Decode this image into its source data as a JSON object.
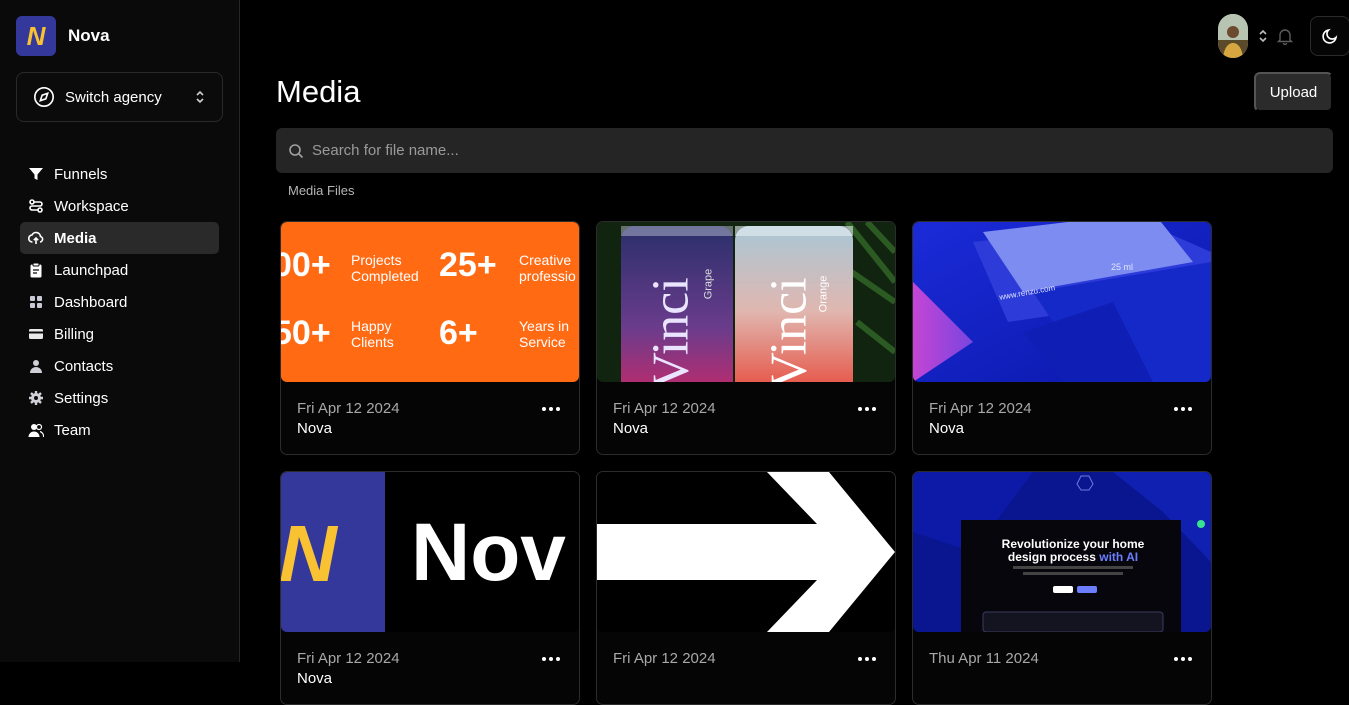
{
  "brand": {
    "name": "Nova",
    "logo_letter": "N",
    "logo_bg": "#34389a",
    "logo_fg": "#f8c232"
  },
  "switch_agency": {
    "label": "Switch agency",
    "icon": "compass-icon"
  },
  "nav": {
    "items": [
      {
        "label": "Funnels",
        "icon": "funnel-icon",
        "active": false
      },
      {
        "label": "Workspace",
        "icon": "workspace-icon",
        "active": false
      },
      {
        "label": "Media",
        "icon": "cloud-upload-icon",
        "active": true
      },
      {
        "label": "Launchpad",
        "icon": "clipboard-icon",
        "active": false
      },
      {
        "label": "Dashboard",
        "icon": "dashboard-icon",
        "active": false
      },
      {
        "label": "Billing",
        "icon": "credit-card-icon",
        "active": false
      },
      {
        "label": "Contacts",
        "icon": "person-icon",
        "active": false
      },
      {
        "label": "Settings",
        "icon": "gear-icon",
        "active": false
      },
      {
        "label": "Team",
        "icon": "team-icon",
        "active": false
      }
    ]
  },
  "page": {
    "title": "Media",
    "upload_label": "Upload",
    "search_placeholder": "Search for file name...",
    "section_label": "Media Files"
  },
  "media": [
    {
      "date": "Fri Apr 12 2024",
      "name": "Nova",
      "thumb": "stats-orange",
      "thumb_text": [
        "00+",
        "Projects",
        "Completed",
        "25+",
        "Creative",
        "professio",
        "50+",
        "Happy",
        "Clients",
        "6+",
        "Years in",
        "Service"
      ]
    },
    {
      "date": "Fri Apr 12 2024",
      "name": "Nova",
      "thumb": "cans",
      "thumb_text": [
        "Vinci",
        "Grape",
        "Vinci",
        "Orange"
      ]
    },
    {
      "date": "Fri Apr 12 2024",
      "name": "Nova",
      "thumb": "blue-box",
      "thumb_text": [
        "25 ml",
        "www.renzu.com"
      ]
    },
    {
      "date": "Fri Apr 12 2024",
      "name": "Nova",
      "thumb": "nova-logo",
      "thumb_text": [
        "N",
        "Nov"
      ]
    },
    {
      "date": "Fri Apr 12 2024",
      "name": "",
      "thumb": "arrow",
      "thumb_text": []
    },
    {
      "date": "Thu Apr 11 2024",
      "name": "",
      "thumb": "website",
      "thumb_text": [
        "Revolutionize your home",
        "design process ",
        "with AI"
      ]
    }
  ],
  "colors": {
    "accent_orange": "#ff6a13",
    "active_nav_bg": "#2a2a2a",
    "ai_highlight": "#6d7dff"
  }
}
